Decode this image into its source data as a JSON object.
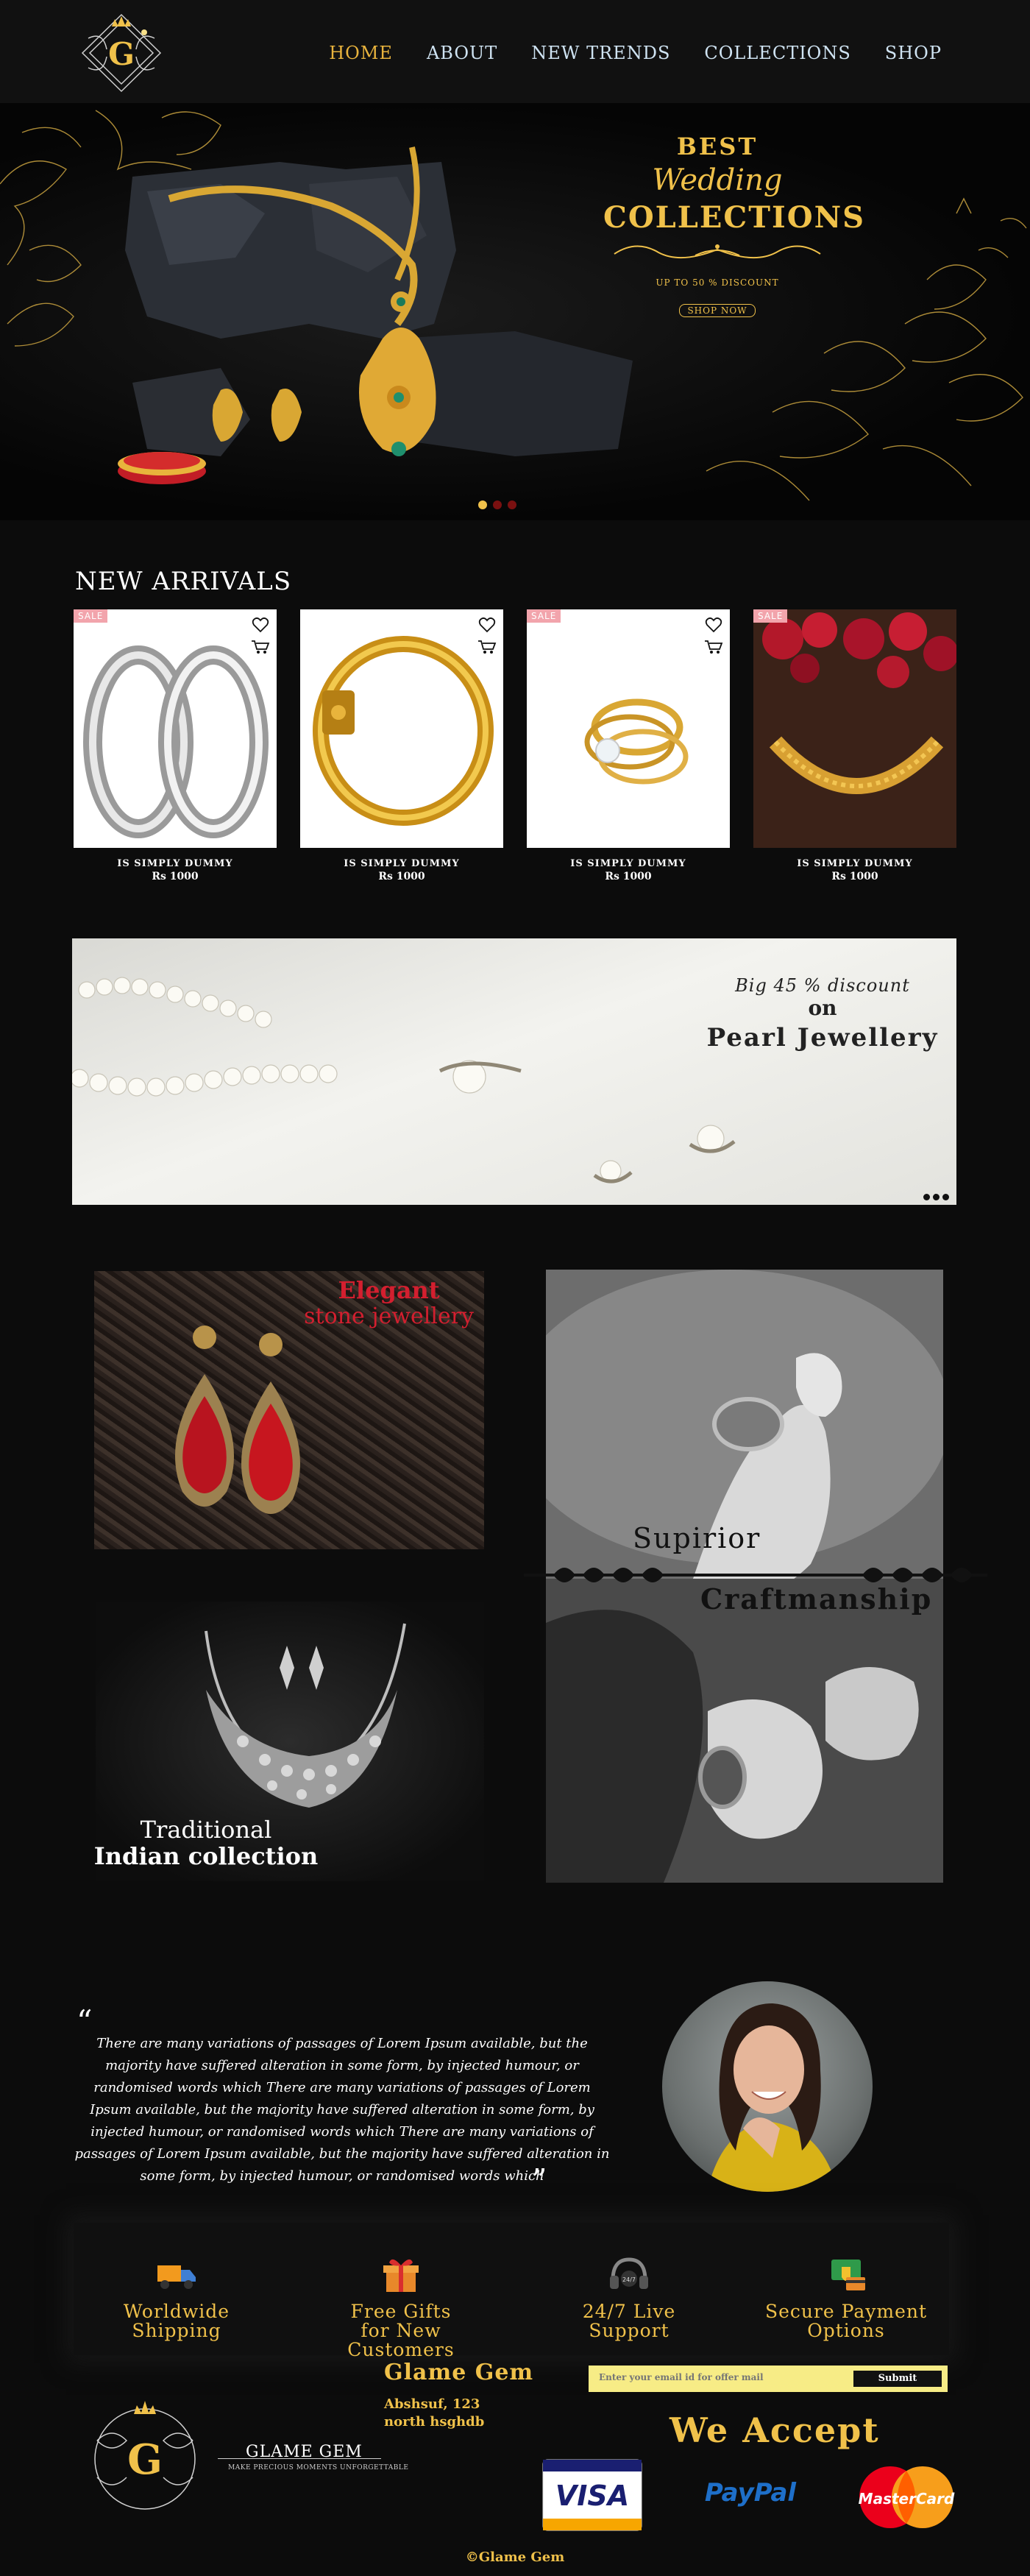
{
  "nav": {
    "logo_letter": "G",
    "links": [
      "HOME",
      "ABOUT",
      "NEW TRENDS",
      "COLLECTIONS",
      "SHOP"
    ],
    "active_index": 0
  },
  "hero": {
    "line1": "BEST",
    "line2": "Wedding",
    "line3": "COLLECTIONS",
    "discount": "UP TO 50 % DISCOUNT",
    "cta": "SHOP NOW",
    "slide_count": 3,
    "active_slide": 0
  },
  "new_arrivals": {
    "title": "NEW ARRIVALS",
    "products": [
      {
        "name": "IS SIMPLY DUMMY",
        "price": "Rs 1000",
        "sale": "SALE",
        "image": "silver-hoop-earrings"
      },
      {
        "name": "IS SIMPLY DUMMY",
        "price": "Rs 1000",
        "sale": "",
        "image": "gold-bangle"
      },
      {
        "name": "IS SIMPLY DUMMY",
        "price": "Rs 1000",
        "sale": "SALE",
        "image": "gold-diamond-ring"
      },
      {
        "name": "IS SIMPLY DUMMY",
        "price": "Rs 1000",
        "sale": "SALE",
        "image": "gold-bracelet"
      }
    ]
  },
  "pearl_banner": {
    "discount": "Big 45 % discount",
    "on": "on",
    "title": "Pearl Jewellery"
  },
  "collections": {
    "stone_title": "Elegant",
    "stone_subtitle": "stone jewellery",
    "craft_word1": "Supirior",
    "craft_word2": "Craftmanship",
    "indian_line1": "Traditional",
    "indian_line2": "Indian collection"
  },
  "testimonial": {
    "open_quote": "“",
    "close_quote": "”",
    "text": "There are many variations of passages of Lorem Ipsum available, but the majority have suffered alteration in some form, by injected humour, or randomised words which There are many variations of passages of Lorem Ipsum available, but the majority have suffered alteration in some form, by injected humour, or randomised words which There are many variations of passages of Lorem Ipsum available, but the majority have suffered alteration in some form, by injected humour, or randomised words which"
  },
  "features": [
    {
      "line1": "Worldwide",
      "line2": "Shipping",
      "icon": "truck-icon"
    },
    {
      "line1": "Free Gifts",
      "line2": "for New Customers",
      "icon": "gift-icon"
    },
    {
      "line1": "24/7 Live",
      "line2": "Support",
      "icon": "headset-icon"
    },
    {
      "line1": "Secure Payment",
      "line2": "Options",
      "icon": "secure-payment-icon"
    }
  ],
  "footer": {
    "logo_letter": "G",
    "brand": "GLAME GEM",
    "tagline": "MAKE PRECIOUS MOMENTS UNFORGETTABLE",
    "company_name": "Glame Gem",
    "address_line1": "Abshsuf, 123",
    "address_line2": "north hsghdb",
    "email_placeholder": "Enter your email id for offer mail",
    "submit_label": "Submit",
    "accept_title": "We Accept",
    "visa": "VISA",
    "paypal": "PayPal",
    "mastercard": "MasterCard",
    "copyright": "©Glame Gem"
  },
  "colors": {
    "gold": "#f0c14a",
    "nav_text": "#cfe3f2",
    "sale_badge": "#f2a4ac",
    "stone_red": "#d31f2f",
    "newsletter_bg": "#f7ec86"
  }
}
